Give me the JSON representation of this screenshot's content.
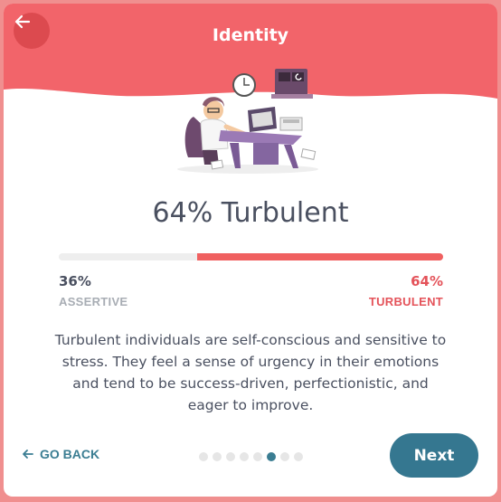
{
  "header": {
    "title": "Identity",
    "back_icon": "arrow-left-icon",
    "color": "#f2646a"
  },
  "result": {
    "headline": "64% Turbulent",
    "assertive_pct_text": "36%",
    "turbulent_pct_text": "64%",
    "assertive_label": "ASSERTIVE",
    "turbulent_label": "TURBULENT",
    "turbulent_fraction": 0.64
  },
  "description": "Turbulent individuals are self-conscious and sensitive to stress. They feel a sense of urgency in their emotions and tend to be success-driven, perfectionistic, and eager to improve.",
  "footer": {
    "go_back_label": "GO BACK",
    "next_label": "Next",
    "steps_total": 8,
    "steps_current": 6
  },
  "colors": {
    "accent": "#357790",
    "turbulent": "#e4535a",
    "track": "#eeeeee"
  }
}
